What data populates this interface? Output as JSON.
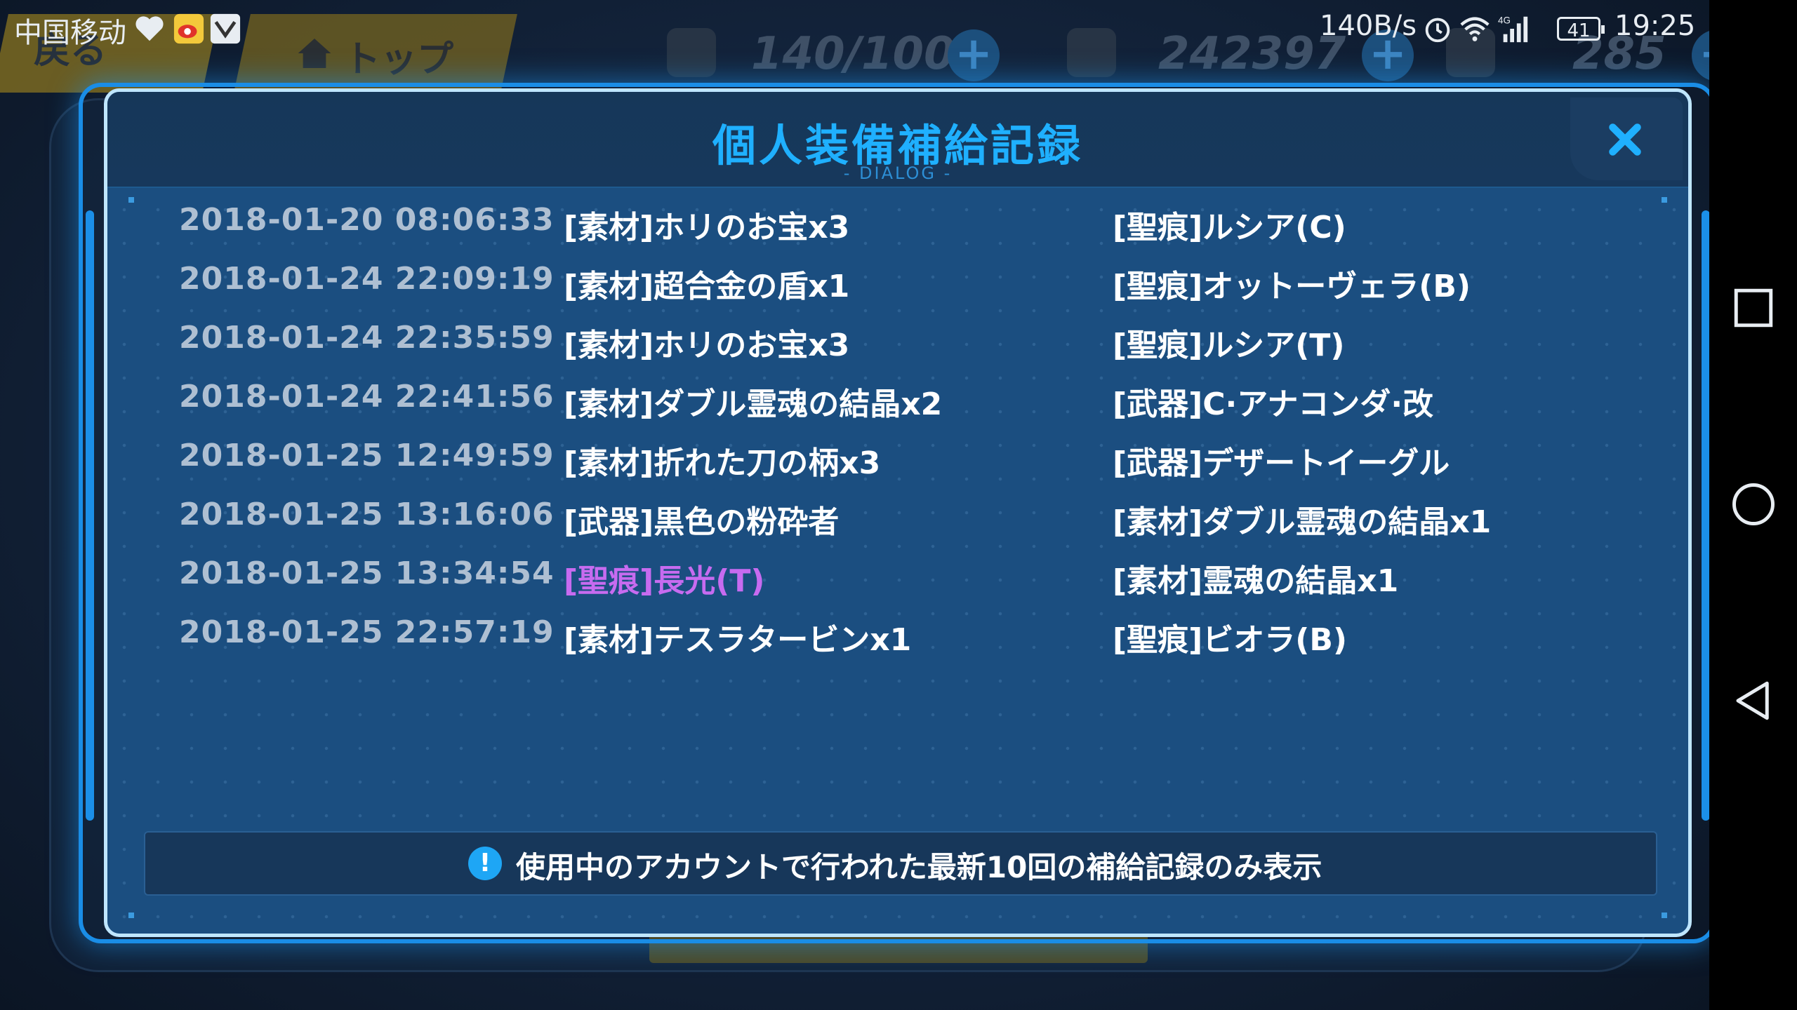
{
  "status_bar": {
    "carrier": "中国移动",
    "net_speed": "140B/s",
    "network_type": "4G",
    "battery_level": "41",
    "time": "19:25"
  },
  "background": {
    "back_button_label": "戻る",
    "top_button_label": "トップ",
    "resources": [
      {
        "icon": "stamina-icon",
        "value": "140/100"
      },
      {
        "icon": "coin-icon",
        "value": "242397"
      },
      {
        "icon": "gem-icon",
        "value": "285"
      }
    ]
  },
  "dialog": {
    "title": "個人装備補給記録",
    "subtitle": "- DIALOG -",
    "close_label": "✕",
    "records": [
      {
        "time": "2018-01-20 08:06:33",
        "item": "[素材]ホリのお宝x3",
        "bonus": "[聖痕]ルシア(C)",
        "highlight": false
      },
      {
        "time": "2018-01-24 22:09:19",
        "item": "[素材]超合金の盾x1",
        "bonus": "[聖痕]オットーヴェラ(B)",
        "highlight": false
      },
      {
        "time": "2018-01-24 22:35:59",
        "item": "[素材]ホリのお宝x3",
        "bonus": "[聖痕]ルシア(T)",
        "highlight": false
      },
      {
        "time": "2018-01-24 22:41:56",
        "item": "[素材]ダブル霊魂の結晶x2",
        "bonus": "[武器]C·アナコンダ·改",
        "highlight": false
      },
      {
        "time": "2018-01-25 12:49:59",
        "item": "[素材]折れた刀の柄x3",
        "bonus": "[武器]デザートイーグル",
        "highlight": false
      },
      {
        "time": "2018-01-25 13:16:06",
        "item": "[武器]黒色の粉砕者",
        "bonus": "[素材]ダブル霊魂の結晶x1",
        "highlight": false
      },
      {
        "time": "2018-01-25 13:34:54",
        "item": "[聖痕]長光(T)",
        "bonus": "[素材]霊魂の結晶x1",
        "highlight": true
      },
      {
        "time": "2018-01-25 22:57:19",
        "item": "[素材]テスラタービンx1",
        "bonus": "[聖痕]ビオラ(B)",
        "highlight": false
      }
    ],
    "notice": {
      "icon": "!",
      "text": "使用中のアカウントで行われた最新10回の補給記録のみ表示"
    }
  },
  "nav_bar": {
    "buttons": [
      "recents",
      "home",
      "back"
    ]
  },
  "colors": {
    "title": "#1fb0ff",
    "highlight_item": "#c76bf0",
    "dialog_border": "#bfe6ff",
    "dialog_bg": "#1b4e80"
  }
}
